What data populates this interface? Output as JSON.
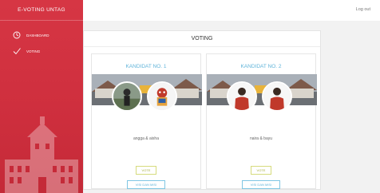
{
  "app": {
    "title": "E-VOTING UNTAG"
  },
  "topbar": {
    "logout_label": "Log out"
  },
  "sidebar": {
    "items": [
      {
        "label": "Dashboard",
        "icon": "dashboard-icon"
      },
      {
        "label": "Voting",
        "icon": "check-icon"
      }
    ]
  },
  "main": {
    "title": "VOTING",
    "candidates": [
      {
        "title": "KANDIDAT NO. 1",
        "names": "angga & aisha",
        "vote_label": "VOTE",
        "visi_label": "VISI DAN MISI"
      },
      {
        "title": "KANDIDAT NO. 2",
        "names": "naira & bayu",
        "vote_label": "VOTE",
        "visi_label": "VISI DAN MISI"
      }
    ]
  },
  "colors": {
    "sidebar_red": "#d63644",
    "accent_blue": "#5fb3d9",
    "vote_olive": "#a6ad3d"
  }
}
